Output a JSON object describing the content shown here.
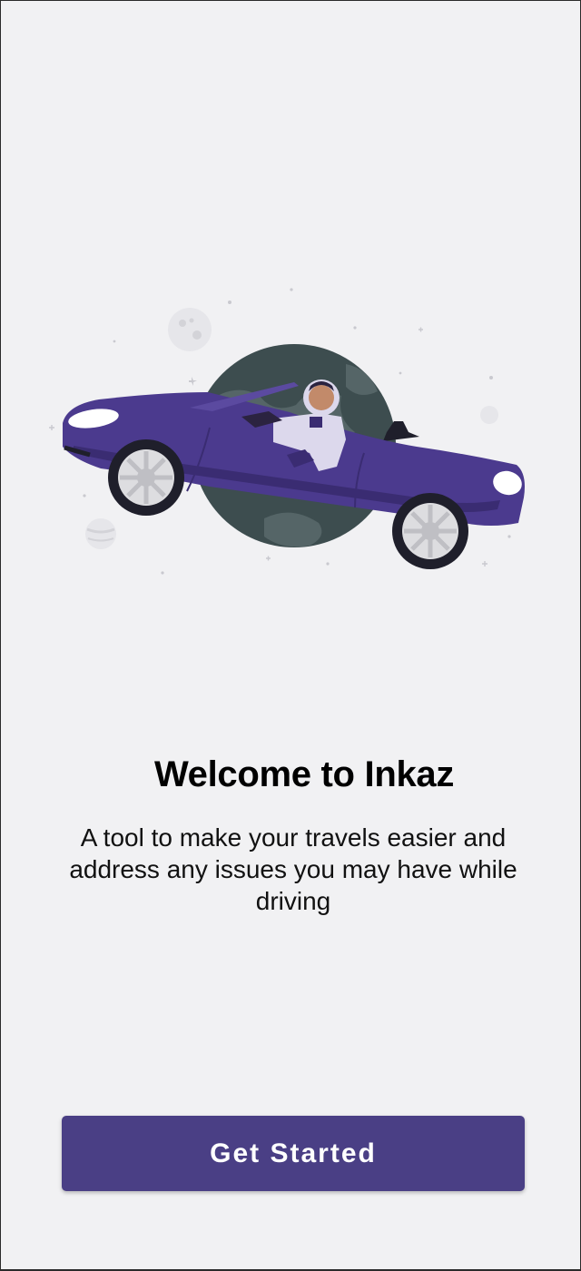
{
  "welcome": {
    "title": "Welcome to Inkaz",
    "description": "A tool to make your travels easier and address any issues you may have while driving"
  },
  "actions": {
    "get_started_label": "Get Started"
  },
  "colors": {
    "background": "#f1f1f3",
    "primary": "#4a3f85",
    "car": "#4b3a8e",
    "planet": "#3d4d4f"
  },
  "illustration": {
    "icon": "astronaut-in-car-illustration"
  }
}
